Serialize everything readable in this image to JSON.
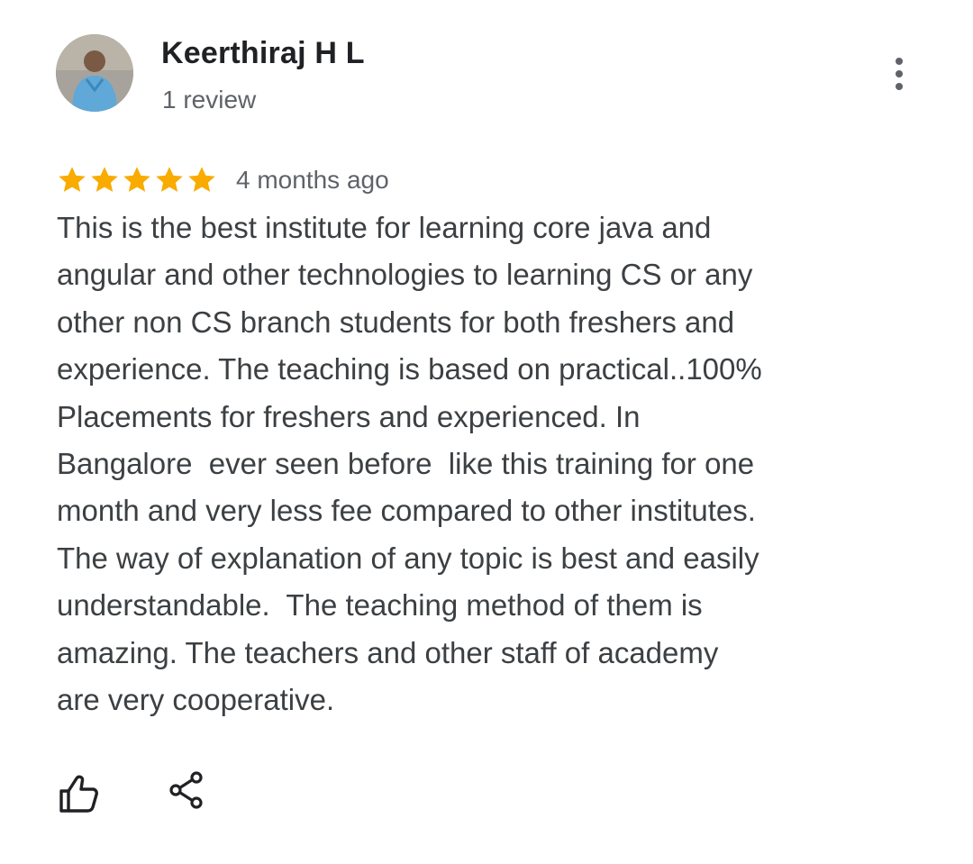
{
  "review": {
    "author_name": "Keerthiraj H L",
    "review_count": "1 review",
    "rating": 5,
    "rating_max": 5,
    "date": "4 months ago",
    "text_lines": [
      "This is the best institute for learning core java and",
      "angular and other technologies to learning CS or any",
      "other non CS branch students for both freshers and",
      "experience. The teaching is based on practical..100%",
      "Placements for freshers and experienced. In",
      "Bangalore  ever seen before  like this training for one",
      "month and very less fee compared to other institutes.",
      "The way of explanation of any topic is best and easily",
      "understandable.  The teaching method of them is",
      "amazing. The teachers and other staff of academy",
      "are very cooperative."
    ]
  },
  "icons": {
    "more": "more-vert-icon",
    "star": "star-icon",
    "like": "thumb-up-icon",
    "share": "share-icon"
  },
  "colors": {
    "star": "#f9ab00",
    "name": "#202124",
    "secondary": "#5f6368",
    "body_text": "#3c4043",
    "icon": "#202124"
  }
}
